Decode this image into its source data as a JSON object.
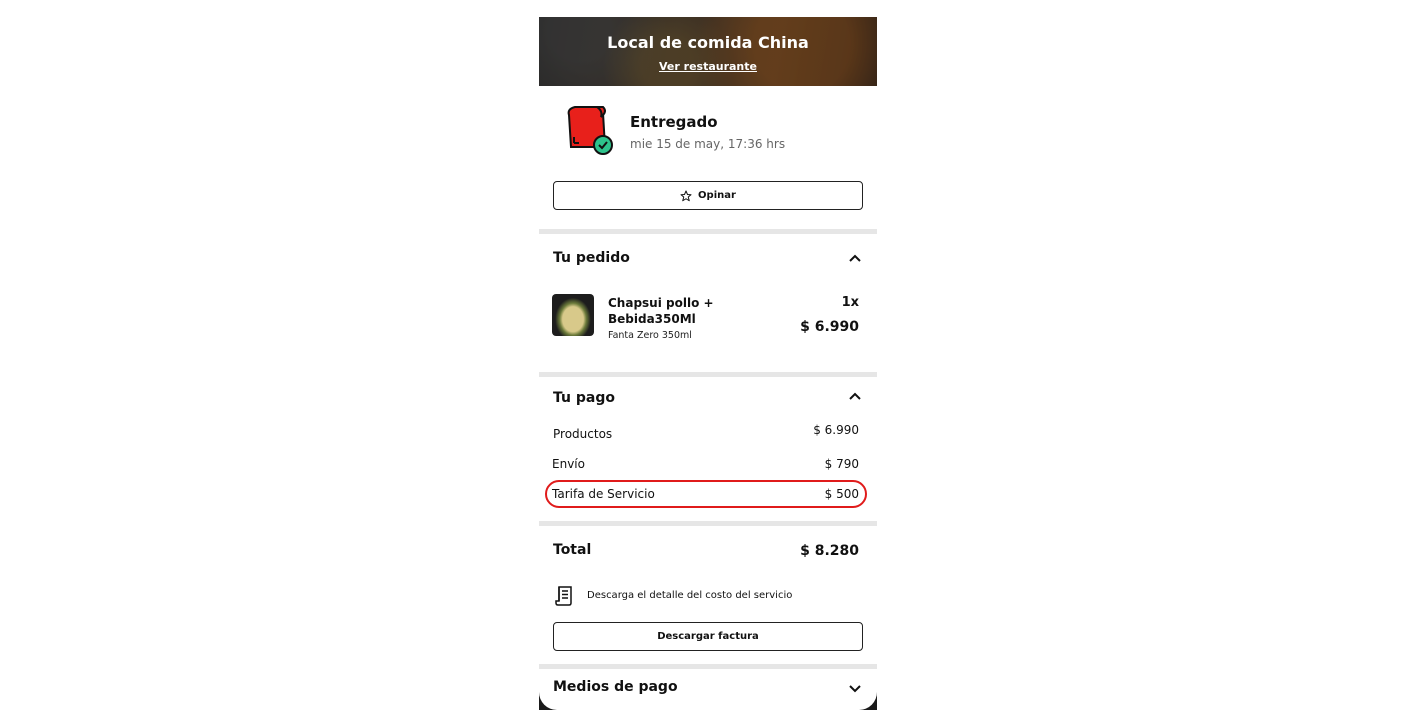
{
  "header": {
    "restaurant_name": "Local de comida China",
    "view_link": "Ver restaurante"
  },
  "status": {
    "title": "Entregado",
    "date": "mie 15 de may, 17:36 hrs",
    "icon": "delivered-bag-icon"
  },
  "rate_button": {
    "label": "Opinar",
    "icon": "star-icon"
  },
  "order": {
    "title": "Tu pedido",
    "items": [
      {
        "name": "Chapsui pollo + Bebida350Ml",
        "detail": "Fanta Zero 350ml",
        "quantity": "1x",
        "price": "$ 6.990"
      }
    ]
  },
  "payment": {
    "title": "Tu pago",
    "rows": [
      {
        "label": "Productos",
        "value": "$ 6.990"
      },
      {
        "label": "Envío",
        "value": "$ 790"
      },
      {
        "label": "Tarifa de Servicio",
        "value": "$ 500"
      }
    ],
    "highlight_color": "#e01b1b"
  },
  "total": {
    "label": "Total",
    "value": "$ 8.280"
  },
  "download_detail": {
    "text": "Descarga el detalle del costo del servicio",
    "icon": "receipt-icon"
  },
  "invoice_button": {
    "label": "Descargar factura"
  },
  "payment_methods": {
    "title": "Medios de pago"
  }
}
